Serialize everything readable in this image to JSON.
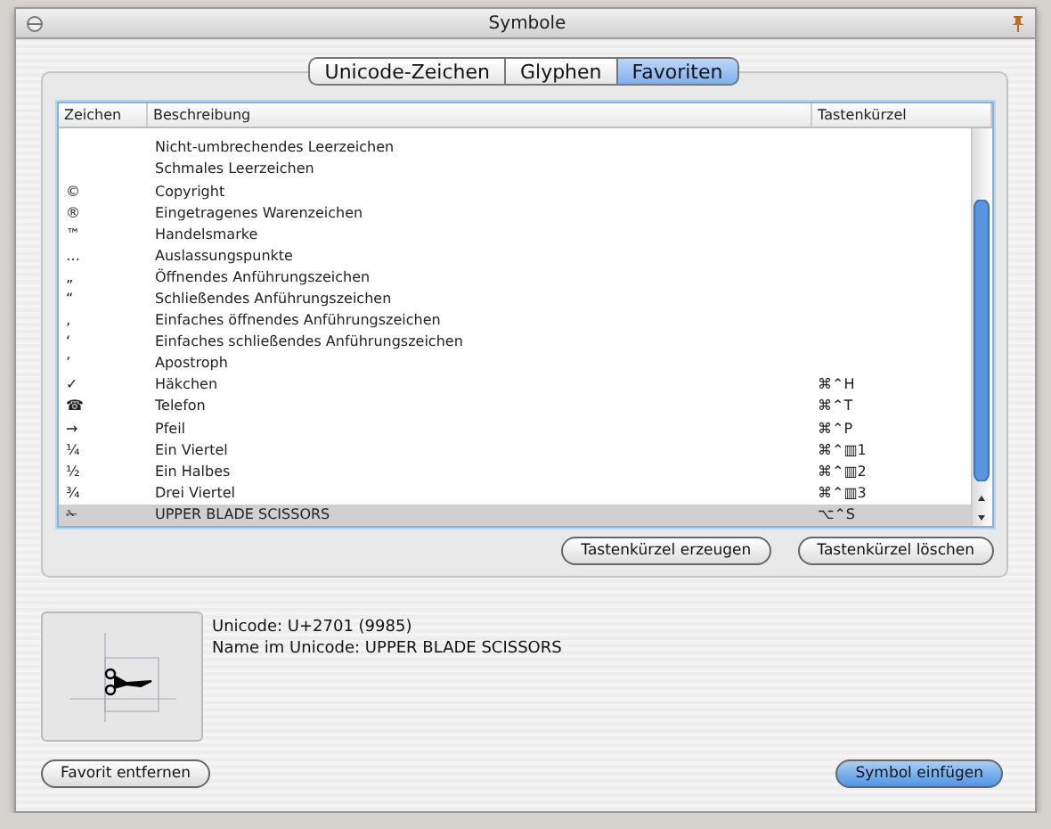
{
  "window": {
    "title": "Symbole"
  },
  "tabs": [
    {
      "label": "Unicode-Zeichen",
      "selected": false
    },
    {
      "label": "Glyphen",
      "selected": false
    },
    {
      "label": "Favoriten",
      "selected": true
    }
  ],
  "table": {
    "columns": [
      "Zeichen",
      "Beschreibung",
      "Tastenkürzel"
    ],
    "rows": [
      {
        "description": "Nicht-umbrechendes Leerzeichen",
        "selected": false
      },
      {
        "description": "Schmales Leerzeichen",
        "selected": false
      },
      {
        "char": "©",
        "description": "Copyright",
        "selected": false
      },
      {
        "char": "®",
        "description": "Eingetragenes Warenzeichen",
        "selected": false
      },
      {
        "char": "™",
        "description": "Handelsmarke",
        "selected": false
      },
      {
        "char": "…",
        "description": "Auslassungspunkte",
        "selected": false
      },
      {
        "char": "„",
        "description": "Öffnendes Anführungszeichen",
        "selected": false
      },
      {
        "char": "“",
        "description": "Schließendes Anführungszeichen",
        "selected": false
      },
      {
        "char": "‚",
        "description": "Einfaches öffnendes Anführungszeichen",
        "selected": false
      },
      {
        "char": "‘",
        "description": "Einfaches schließendes Anführungszeichen",
        "selected": false
      },
      {
        "char": "’",
        "description": "Apostroph",
        "selected": false
      },
      {
        "char": "✓",
        "description": "Häkchen",
        "shortcut": "⌘⌃H",
        "selected": false
      },
      {
        "char": "☎",
        "description": "Telefon",
        "shortcut": "⌘⌃T",
        "selected": false
      },
      {
        "char": "→",
        "description": "Pfeil",
        "shortcut": "⌘⌃P",
        "selected": false
      },
      {
        "char": "¼",
        "description": "Ein Viertel",
        "shortcut": "⌘⌃▥1",
        "selected": false
      },
      {
        "char": "½",
        "description": "Ein Halbes",
        "shortcut": "⌘⌃▥2",
        "selected": false
      },
      {
        "char": "¾",
        "description": "Drei Viertel",
        "shortcut": "⌘⌃▥3",
        "selected": false
      },
      {
        "char": "✁",
        "description": "UPPER BLADE SCISSORS",
        "shortcut": "⌥⌃S",
        "selected": true
      }
    ]
  },
  "table_buttons": [
    "Tastenkürzel erzeugen",
    "Tastenkürzel löschen"
  ],
  "info": {
    "unicode": "Unicode: U+2701 (9985)",
    "name": "Name im Unicode: UPPER BLADE SCISSORS"
  },
  "buttons": [
    {
      "label": "Favorit entfernen",
      "default": false
    },
    {
      "label": "Symbol einfügen",
      "default": true
    }
  ]
}
